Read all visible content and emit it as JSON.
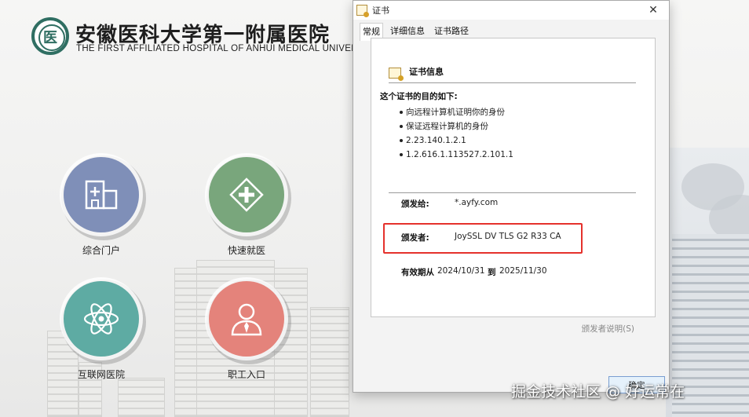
{
  "hospital": {
    "name_cn": "安徽医科大学第一附属医院",
    "name_en": "THE FIRST AFFILIATED HOSPITAL OF ANHUI MEDICAL UNIVERSITY",
    "logo_glyph": "医"
  },
  "entries": [
    {
      "label": "综合门户",
      "icon": "hospital-building-icon",
      "color": "#7f8fb8"
    },
    {
      "label": "快速就医",
      "icon": "medical-cross-icon",
      "color": "#79a67c"
    },
    {
      "label": "互联网医院",
      "icon": "atom-icon",
      "color": "#5eaba3"
    },
    {
      "label": "职工入口",
      "icon": "staff-person-icon",
      "color": "#e4837b"
    }
  ],
  "dialog": {
    "title": "证书",
    "close": "✕",
    "tabs": [
      "常规",
      "详细信息",
      "证书路径"
    ],
    "cert_info_title": "证书信息",
    "purpose_title": "这个证书的目的如下:",
    "purposes": [
      "向远程计算机证明你的身份",
      "保证远程计算机的身份",
      "2.23.140.1.2.1",
      "1.2.616.1.113527.2.101.1"
    ],
    "issued_to_label": "颁发给:",
    "issued_to": "*.ayfy.com",
    "issued_by_label": "颁发者:",
    "issued_by": "JoySSL DV TLS G2 R33 CA",
    "valid_from_label": "有效期从",
    "valid_from": "2024/10/31",
    "valid_to_label": "到",
    "valid_to": "2025/11/30",
    "issuer_statement": "颁发者说明(S)",
    "ok_button": "确定",
    "highlight_color": "#e5312c"
  },
  "watermark": "掘金技术社区 @ 好运常在"
}
